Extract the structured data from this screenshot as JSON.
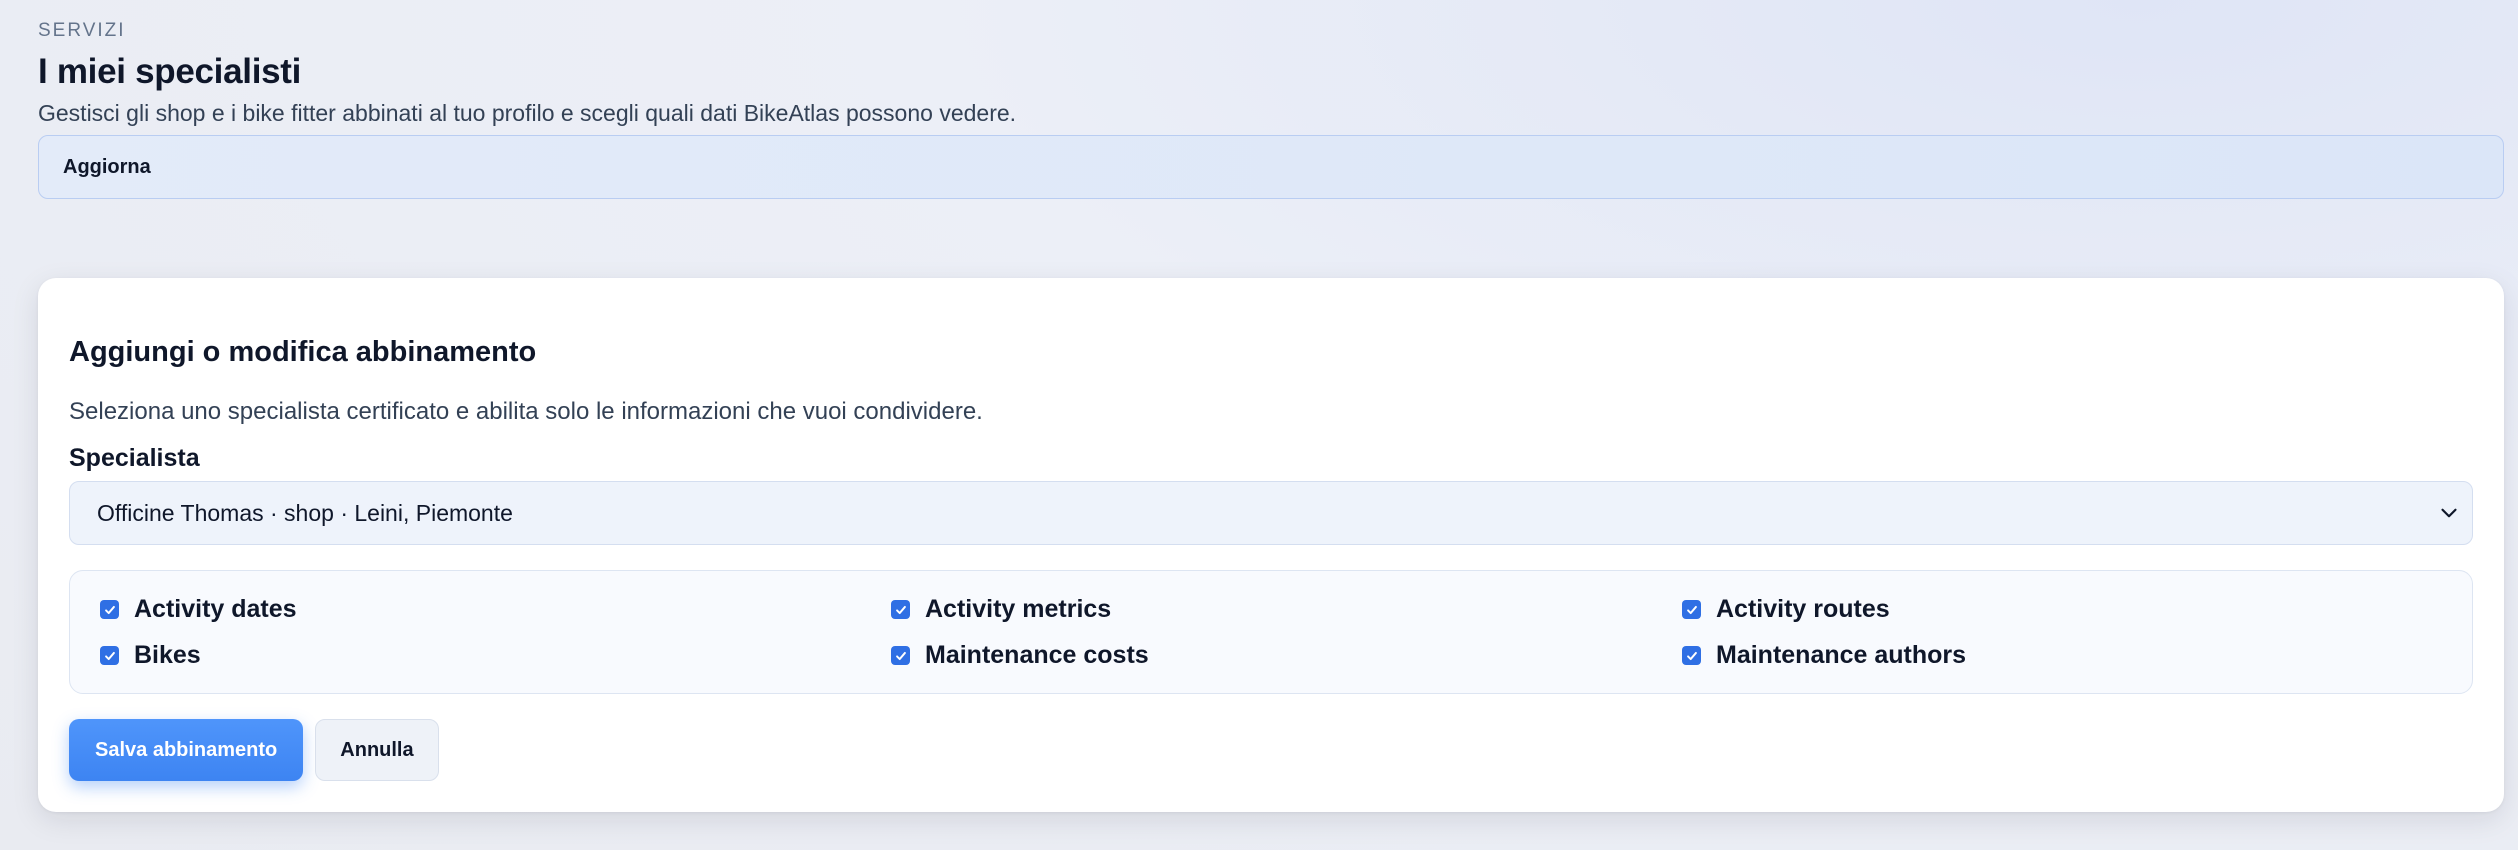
{
  "header": {
    "eyebrow": "SERVIZI",
    "title": "I miei specialisti",
    "subtitle": "Gestisci gli shop e i bike fitter abbinati al tuo profilo e scegli quali dati BikeAtlas possono vedere."
  },
  "refresh": {
    "label": "Aggiorna"
  },
  "form": {
    "title": "Aggiungi o modifica abbinamento",
    "description": "Seleziona uno specialista certificato e abilita solo le informazioni che vuoi condividere.",
    "specialist_label": "Specialista",
    "specialist_value": "Officine Thomas · shop · Leini, Piemonte",
    "permissions": [
      {
        "label": "Activity dates",
        "checked": true
      },
      {
        "label": "Activity metrics",
        "checked": true
      },
      {
        "label": "Activity routes",
        "checked": true
      },
      {
        "label": "Bikes",
        "checked": true
      },
      {
        "label": "Maintenance costs",
        "checked": true
      },
      {
        "label": "Maintenance authors",
        "checked": true
      }
    ],
    "save_label": "Salva abbinamento",
    "cancel_label": "Annulla"
  },
  "colors": {
    "accent": "#3d84f2",
    "checkbox": "#2f6fe4",
    "text": "#0f172a"
  }
}
